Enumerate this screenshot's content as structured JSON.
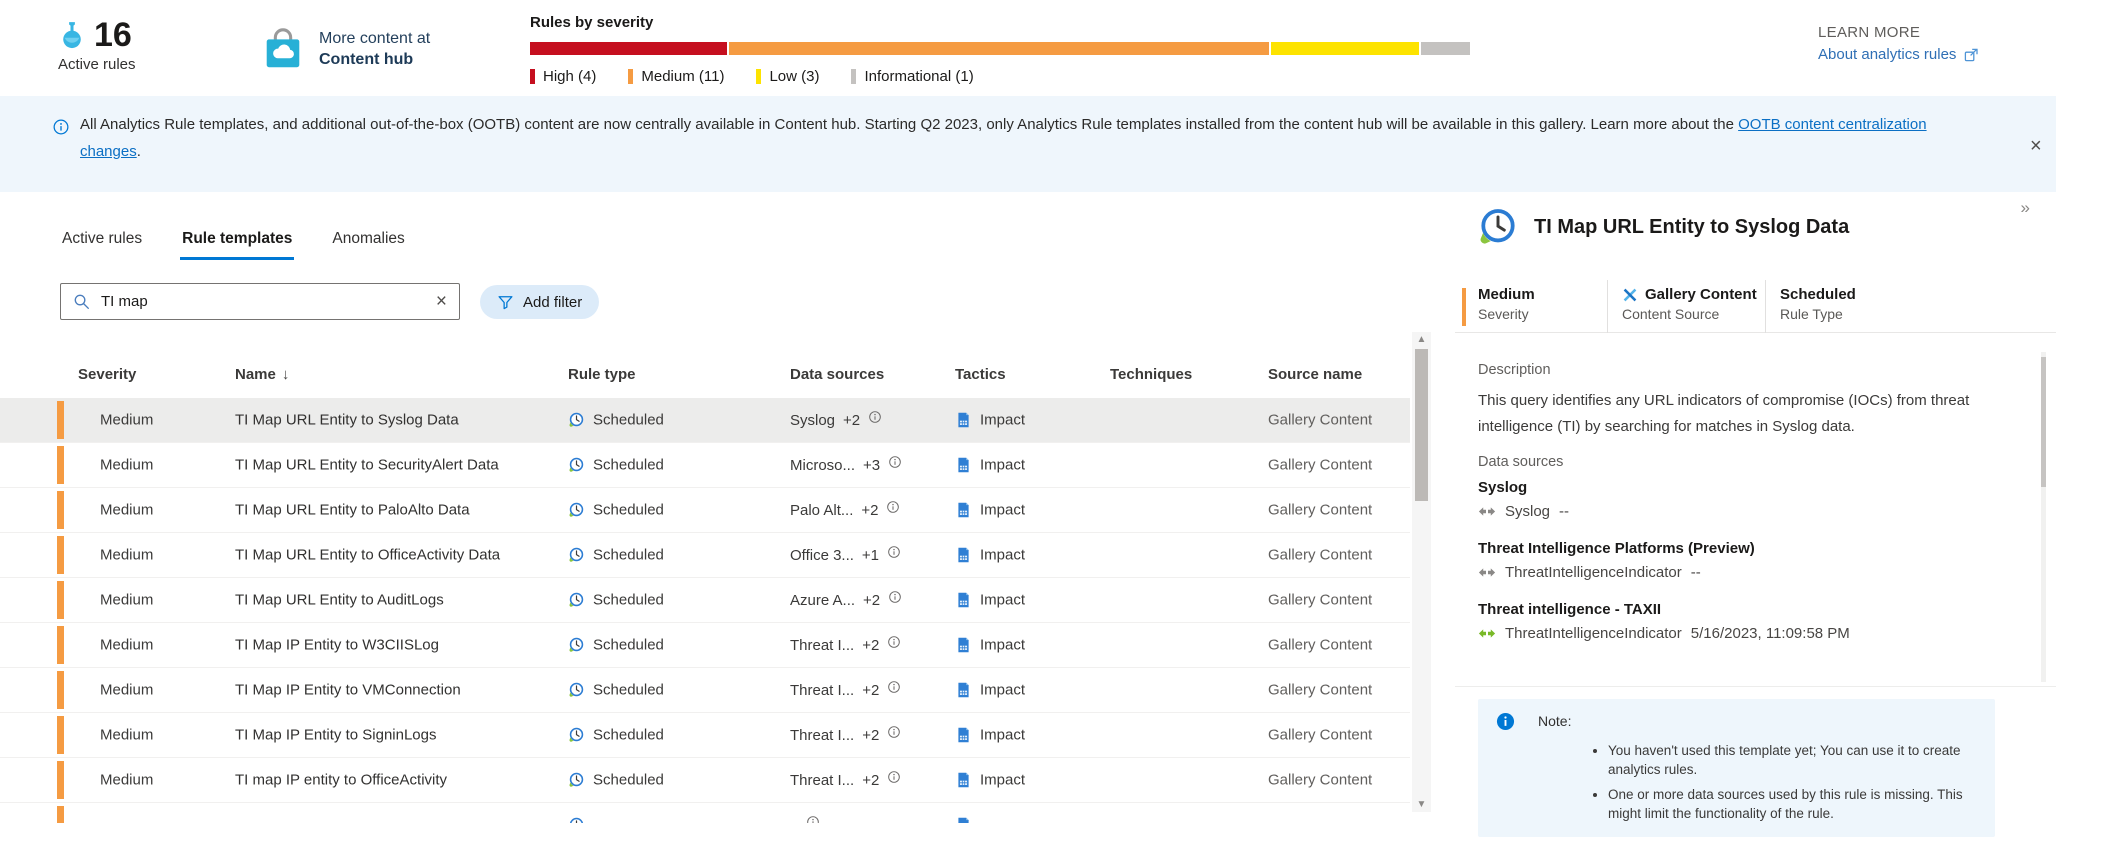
{
  "app": {
    "accent_color": "#0078d4"
  },
  "header": {
    "active_rules": {
      "count": "16",
      "label": "Active rules"
    },
    "content_hub": {
      "line1": "More content at",
      "line2": "Content hub"
    },
    "severity_chart": {
      "type": "bar",
      "title": "Rules by severity",
      "segments": [
        {
          "label": "High",
          "count": 4,
          "color": "#c50f1f"
        },
        {
          "label": "Medium",
          "count": 11,
          "color": "#f59b42"
        },
        {
          "label": "Low",
          "count": 3,
          "color": "#fde300"
        },
        {
          "label": "Informational",
          "count": 1,
          "color": "#c4c2c0"
        }
      ],
      "legend": [
        "High (4)",
        "Medium (11)",
        "Low (3)",
        "Informational (1)"
      ]
    },
    "learn_more": {
      "label": "LEARN MORE",
      "link": "About analytics rules"
    }
  },
  "banner": {
    "text_before_link": "All Analytics Rule templates, and additional out-of-the-box (OOTB) content are now centrally available in Content hub. Starting Q2 2023, only Analytics Rule templates installed from the content hub will be available in this gallery. Learn more about the ",
    "link_text": "OOTB content centralization changes",
    "text_after_link": "."
  },
  "icons": {
    "close": "×",
    "collapse": "»",
    "sort_desc": "↓"
  },
  "tabs": [
    {
      "label": "Active rules",
      "active": false
    },
    {
      "label": "Rule templates",
      "active": true
    },
    {
      "label": "Anomalies",
      "active": false
    }
  ],
  "toolbar": {
    "search_value": "TI map",
    "add_filter_label": "Add filter"
  },
  "table": {
    "columns": {
      "severity": "Severity",
      "name": "Name",
      "rule_type": "Rule type",
      "data_sources": "Data sources",
      "tactics": "Tactics",
      "techniques": "Techniques",
      "source_name": "Source name"
    },
    "rows": [
      {
        "severity": "Medium",
        "name": "TI Map URL Entity to Syslog Data",
        "rule_type": "Scheduled",
        "data_source": "Syslog",
        "data_source_more": "+2",
        "tactics": "Impact",
        "source_name": "Gallery Content",
        "selected": true
      },
      {
        "severity": "Medium",
        "name": "TI Map URL Entity to SecurityAlert Data",
        "rule_type": "Scheduled",
        "data_source": "Microso...",
        "data_source_more": "+3",
        "tactics": "Impact",
        "source_name": "Gallery Content",
        "selected": false
      },
      {
        "severity": "Medium",
        "name": "TI Map URL Entity to PaloAlto Data",
        "rule_type": "Scheduled",
        "data_source": "Palo Alt...",
        "data_source_more": "+2",
        "tactics": "Impact",
        "source_name": "Gallery Content",
        "selected": false
      },
      {
        "severity": "Medium",
        "name": "TI Map URL Entity to OfficeActivity Data",
        "rule_type": "Scheduled",
        "data_source": "Office 3...",
        "data_source_more": "+1",
        "tactics": "Impact",
        "source_name": "Gallery Content",
        "selected": false
      },
      {
        "severity": "Medium",
        "name": "TI Map URL Entity to AuditLogs",
        "rule_type": "Scheduled",
        "data_source": "Azure A...",
        "data_source_more": "+2",
        "tactics": "Impact",
        "source_name": "Gallery Content",
        "selected": false
      },
      {
        "severity": "Medium",
        "name": "TI Map IP Entity to W3CIISLog",
        "rule_type": "Scheduled",
        "data_source": "Threat I...",
        "data_source_more": "+2",
        "tactics": "Impact",
        "source_name": "Gallery Content",
        "selected": false
      },
      {
        "severity": "Medium",
        "name": "TI Map IP Entity to VMConnection",
        "rule_type": "Scheduled",
        "data_source": "Threat I...",
        "data_source_more": "+2",
        "tactics": "Impact",
        "source_name": "Gallery Content",
        "selected": false
      },
      {
        "severity": "Medium",
        "name": "TI Map IP Entity to SigninLogs",
        "rule_type": "Scheduled",
        "data_source": "Threat I...",
        "data_source_more": "+2",
        "tactics": "Impact",
        "source_name": "Gallery Content",
        "selected": false
      },
      {
        "severity": "Medium",
        "name": "TI map IP entity to OfficeActivity",
        "rule_type": "Scheduled",
        "data_source": "Threat I...",
        "data_source_more": "+2",
        "tactics": "Impact",
        "source_name": "Gallery Content",
        "selected": false
      }
    ]
  },
  "panel": {
    "title": "TI Map URL Entity to Syslog Data",
    "meta": {
      "severity": {
        "value": "Medium",
        "label": "Severity"
      },
      "content_source": {
        "value": "Gallery Content",
        "label": "Content Source"
      },
      "rule_type": {
        "value": "Scheduled",
        "label": "Rule Type"
      }
    },
    "description": {
      "label": "Description",
      "text": "This query identifies any URL indicators of compromise (IOCs) from threat intelligence (TI) by searching for matches in Syslog data."
    },
    "data_sources": {
      "label": "Data sources",
      "items": [
        {
          "name": "Syslog",
          "table": "Syslog",
          "status": "--",
          "connected": false
        },
        {
          "name": "Threat Intelligence Platforms (Preview)",
          "table": "ThreatIntelligenceIndicator",
          "status": "--",
          "connected": false
        },
        {
          "name": "Threat intelligence - TAXII",
          "table": "ThreatIntelligenceIndicator",
          "status": "5/16/2023, 11:09:58 PM",
          "connected": true
        }
      ]
    },
    "note": {
      "label": "Note:",
      "items": [
        "You haven't used this template yet; You can use it to create analytics rules.",
        "One or more data sources used by this rule is missing. This might limit the functionality of the rule."
      ]
    }
  }
}
